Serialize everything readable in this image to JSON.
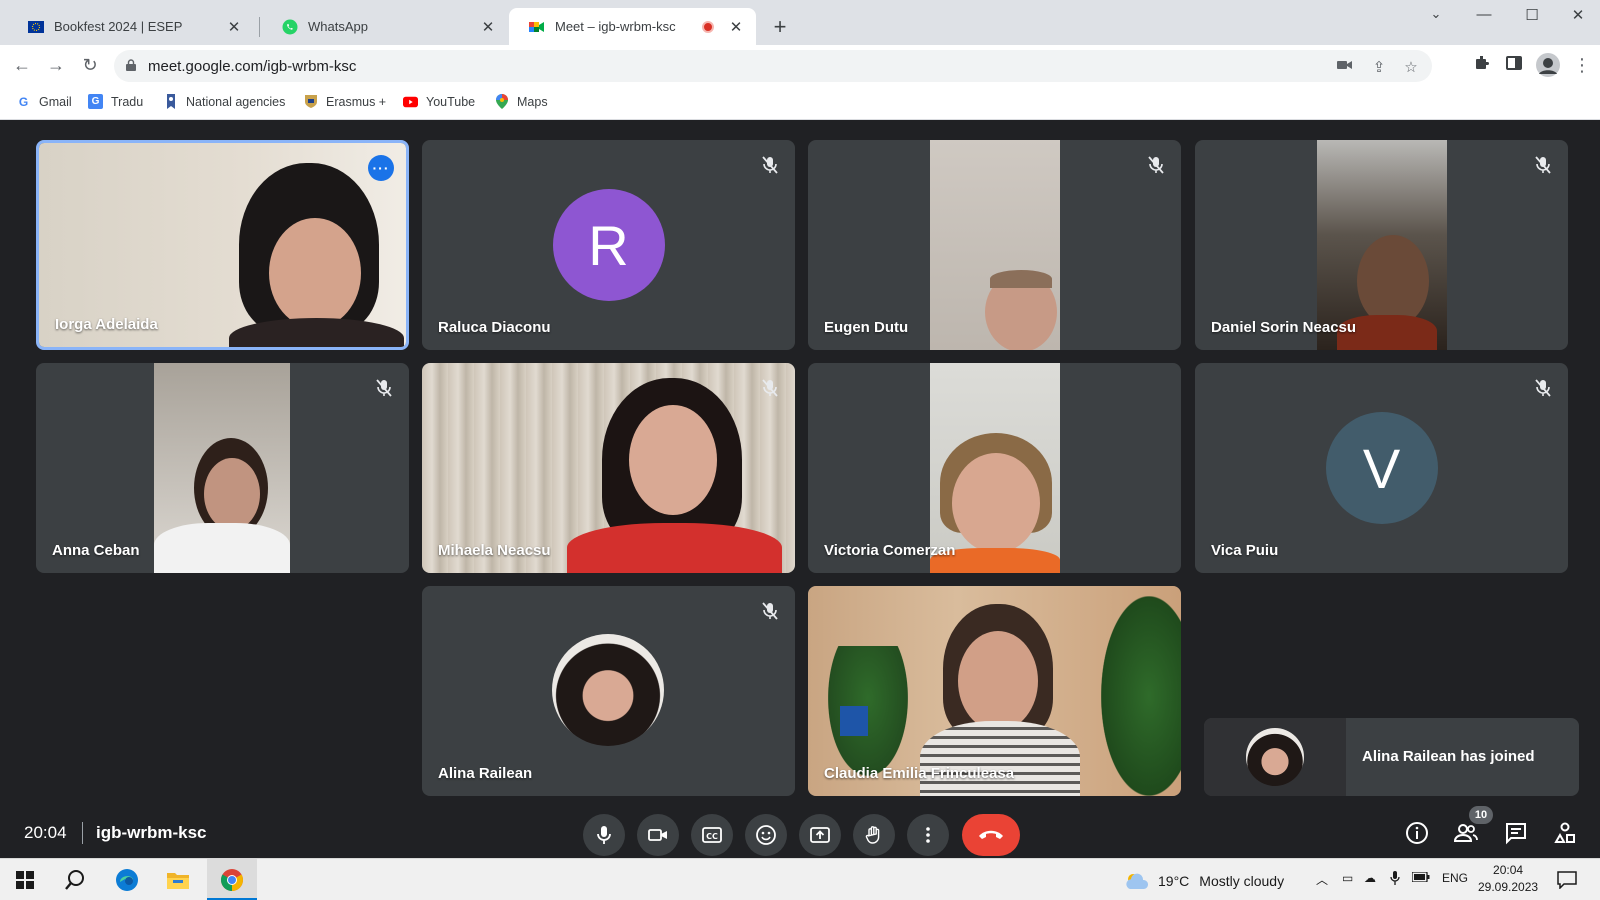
{
  "browser": {
    "tabs": [
      {
        "title": "Bookfest 2024 | ESEP",
        "icon": "eu-flag-icon"
      },
      {
        "title": "WhatsApp",
        "icon": "whatsapp-icon"
      },
      {
        "title": "Meet – igb-wrbm-ksc",
        "icon": "meet-icon",
        "recording": true
      }
    ],
    "url": "meet.google.com/igb-wrbm-ksc",
    "bookmarks": [
      "Gmail",
      "Tradu",
      "National agencies",
      "Erasmus +",
      "YouTube",
      "Maps"
    ]
  },
  "participants": [
    {
      "name": "Iorga Adelaida"
    },
    {
      "name": "Raluca Diaconu",
      "initial": "R",
      "color": "#8e56d2"
    },
    {
      "name": "Eugen Dutu"
    },
    {
      "name": "Daniel Sorin Neacsu"
    },
    {
      "name": "Anna Ceban"
    },
    {
      "name": "Mihaela Neacsu"
    },
    {
      "name": "Victoria Comerzan"
    },
    {
      "name": "Vica Puiu",
      "initial": "V",
      "color": "#425c6b"
    },
    {
      "name": "Alina Railean"
    },
    {
      "name": "Claudia Emilia Frinculeasa"
    }
  ],
  "toast": {
    "text": "Alina Railean has joined"
  },
  "meeting": {
    "time": "20:04",
    "code": "igb-wrbm-ksc",
    "participant_count": "10"
  },
  "taskbar": {
    "temperature": "19°C",
    "weather": "Mostly cloudy",
    "lang": "ENG",
    "time": "20:04",
    "date": "29.09.2023"
  },
  "colors": {
    "hangup": "#ea4335",
    "focus_border": "#8ab4f8",
    "accent": "#1a73e8"
  }
}
